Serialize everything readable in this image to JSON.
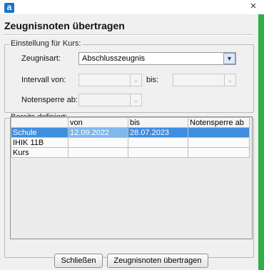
{
  "window": {
    "app_icon_letter": "a",
    "close_glyph": "×"
  },
  "dialog": {
    "title": "Zeugnisnoten übertragen"
  },
  "settings_group": {
    "legend": "Einstellung für Kurs:",
    "zeugnisart_label": "Zeugnisart:",
    "zeugnisart_value": "Abschlusszeugnis",
    "intervall_von_label": "Intervall von:",
    "intervall_von_value": "",
    "bis_label": "bis:",
    "bis_value": "",
    "notensperre_label": "Notensperre ab:",
    "notensperre_value": ""
  },
  "defined_group": {
    "legend": "Bereits definiert:",
    "columns": [
      "",
      "von",
      "bis",
      "Notensperre ab"
    ],
    "rows": [
      [
        "Schule",
        "12.09.2022",
        "28.07.2023",
        ""
      ],
      [
        "IHIK 11B",
        "",
        "",
        ""
      ],
      [
        "Kurs",
        "",
        "",
        ""
      ]
    ]
  },
  "buttons": {
    "close_label": "Schließen",
    "transfer_label": "Zeugnisnoten übertragen"
  },
  "colors": {
    "selection": "#3f8ee0",
    "accent_strip": "#2fae4a",
    "app_icon": "#1a73c8"
  }
}
